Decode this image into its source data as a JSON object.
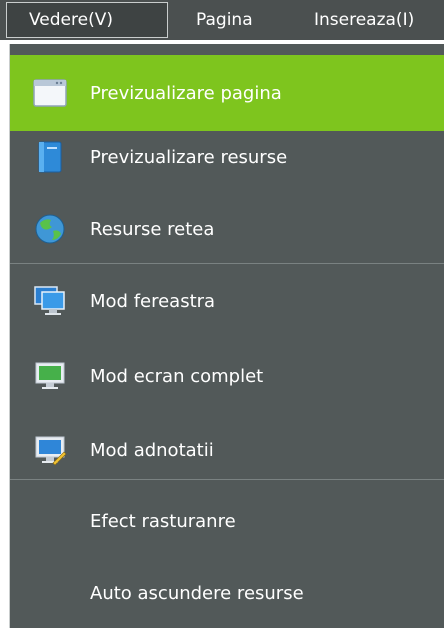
{
  "menubar": {
    "items": [
      {
        "label": "Vedere(V)"
      },
      {
        "label": "Pagina"
      },
      {
        "label": "Insereaza(I)"
      }
    ]
  },
  "menu": {
    "items": [
      {
        "label": "Previzualizare pagina",
        "icon": "page-window-icon",
        "selected": true
      },
      {
        "label": "Previzualizare resurse",
        "icon": "book-icon"
      },
      {
        "label": "Resurse retea",
        "icon": "globe-icon"
      },
      {
        "label": "Mod fereastra",
        "icon": "windows-monitor-icon"
      },
      {
        "label": "Mod ecran complet",
        "icon": "monitor-icon"
      },
      {
        "label": "Mod adnotatii",
        "icon": "annotation-monitor-icon"
      },
      {
        "label": "Efect rasturanre"
      },
      {
        "label": "Auto ascundere resurse"
      }
    ]
  },
  "colors": {
    "menubar": "#4b5050",
    "menu": "#525959",
    "selected": "#7ec51e"
  }
}
